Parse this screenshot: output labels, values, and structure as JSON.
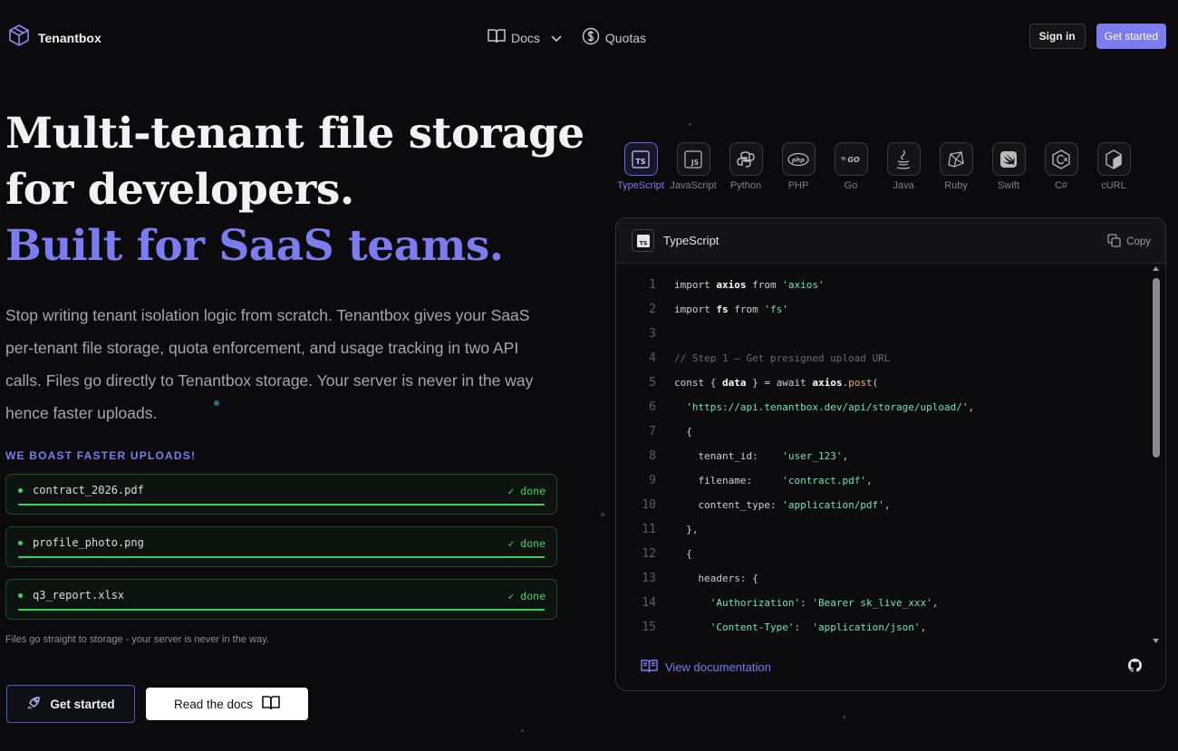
{
  "nav": {
    "brand": "Tenantbox",
    "links": [
      {
        "label": "Docs",
        "icon": "book-icon",
        "has_dropdown": true
      },
      {
        "label": "Quotas",
        "icon": "dollar-circle-icon",
        "has_dropdown": false
      }
    ],
    "signin": "Sign in",
    "get_started": "Get started"
  },
  "hero": {
    "title_line1": "Multi-tenant file storage",
    "title_line2": "for developers.",
    "title_accent": "Built for SaaS teams.",
    "lead": "Stop writing tenant isolation logic from scratch. Tenantbox gives your SaaS per-tenant file storage, quota enforcement, and usage tracking in two API calls. Files go directly to Tenantbox storage. Your server is never in the way hence faster uploads."
  },
  "uploads": {
    "eyebrow": "WE BOAST FASTER UPLOADS!",
    "items": [
      {
        "file": "contract_2026.pdf",
        "status": "✓ done",
        "progress": 1.0
      },
      {
        "file": "profile_photo.png",
        "status": "✓ done",
        "progress": 1.0
      },
      {
        "file": "q3_report.xlsx",
        "status": "✓ done",
        "progress": 1.0
      }
    ],
    "note": "Files go straight to storage - your server is never in the way."
  },
  "cta": {
    "primary": "Get started",
    "secondary": "Read the docs"
  },
  "languages": [
    {
      "label": "TypeScript",
      "icon": "typescript-icon",
      "active": true
    },
    {
      "label": "JavaScript",
      "icon": "javascript-icon",
      "active": false
    },
    {
      "label": "Python",
      "icon": "python-icon",
      "active": false
    },
    {
      "label": "PHP",
      "icon": "php-icon",
      "active": false
    },
    {
      "label": "Go",
      "icon": "go-icon",
      "active": false
    },
    {
      "label": "Java",
      "icon": "java-icon",
      "active": false
    },
    {
      "label": "Ruby",
      "icon": "ruby-icon",
      "active": false
    },
    {
      "label": "Swift",
      "icon": "swift-icon",
      "active": false
    },
    {
      "label": "C#",
      "icon": "csharp-icon",
      "active": false
    },
    {
      "label": "cURL",
      "icon": "curl-icon",
      "active": false
    }
  ],
  "code_panel": {
    "title": "TypeScript",
    "copy": "Copy",
    "doc_link": "View documentation",
    "lines": [
      {
        "n": "1",
        "code": "import axios from 'axios'"
      },
      {
        "n": "2",
        "code": "import fs from 'fs'"
      },
      {
        "n": "3",
        "code": ""
      },
      {
        "n": "4",
        "code": "// Step 1 — Get presigned upload URL"
      },
      {
        "n": "5",
        "code": "const { data } = await axios.post("
      },
      {
        "n": "6",
        "code": "  'https://api.tenantbox.dev/api/storage/upload/',"
      },
      {
        "n": "7",
        "code": "  {"
      },
      {
        "n": "8",
        "code": "    tenant_id:    'user_123',"
      },
      {
        "n": "9",
        "code": "    filename:     'contract.pdf',"
      },
      {
        "n": "10",
        "code": "    content_type: 'application/pdf',"
      },
      {
        "n": "11",
        "code": "  },"
      },
      {
        "n": "12",
        "code": "  {"
      },
      {
        "n": "13",
        "code": "    headers: {"
      },
      {
        "n": "14",
        "code": "      'Authorization': 'Bearer sk_live_xxx',"
      },
      {
        "n": "15",
        "code": "      'Content-Type':  'application/json',"
      }
    ]
  },
  "colors": {
    "accent": "#7b7cf0",
    "success": "#3ed66a",
    "background": "#0b0b0d"
  }
}
